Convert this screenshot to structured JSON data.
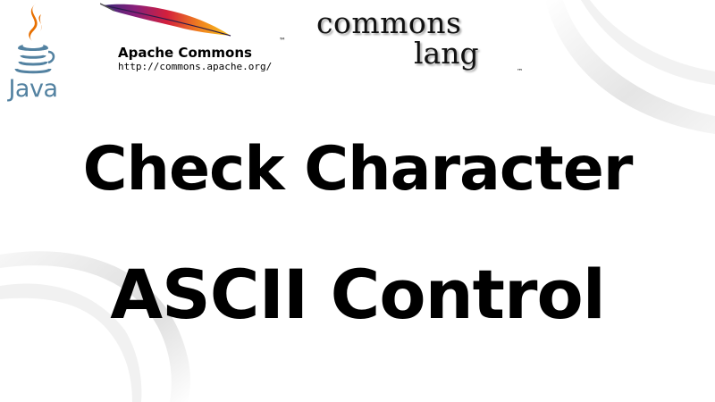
{
  "logos": {
    "java": {
      "label": "Java",
      "icon": "java-coffee-cup-icon",
      "colors": {
        "cup": "#5382a1",
        "steam": "#e76f00"
      }
    },
    "apache": {
      "title": "Apache Commons",
      "trademark": "™",
      "url": "http://commons.apache.org/",
      "icon": "apache-feather-icon"
    },
    "commons_lang": {
      "line1": "commons",
      "line2": "lang",
      "trademark": "™"
    }
  },
  "title": {
    "line1": "Check Character",
    "line2": "ASCII Control"
  }
}
